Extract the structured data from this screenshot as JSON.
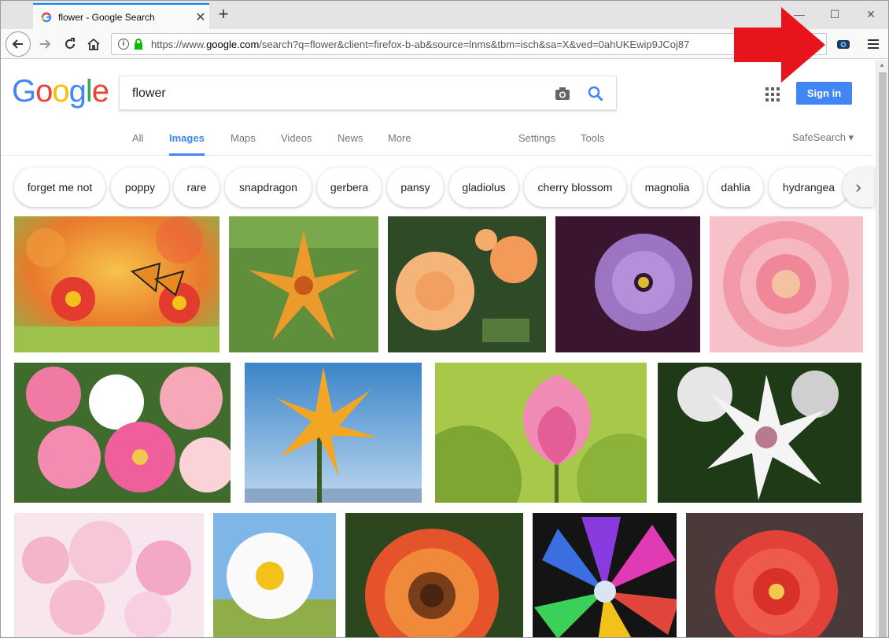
{
  "browser": {
    "tab_title": "flower - Google Search",
    "tab_close": "✕",
    "new_tab": "+",
    "url_scheme": "https://www.",
    "url_host": "google.com",
    "url_rest": "/search?q=flower&client=firefox-b-ab&source=lnms&tbm=isch&sa=X&ved=0ahUKEwip9JCoj87",
    "minimize": "—",
    "maximize": "☐",
    "close": "✕"
  },
  "google": {
    "logo_letters": [
      "G",
      "o",
      "o",
      "g",
      "l",
      "e"
    ],
    "search_value": "flower",
    "signin_label": "Sign in",
    "tabs": [
      "All",
      "Images",
      "Maps",
      "Videos",
      "News",
      "More",
      "Settings",
      "Tools"
    ],
    "safesearch_label": "SafeSearch ▾"
  },
  "chips": [
    "forget me not",
    "poppy",
    "rare",
    "snapdragon",
    "gerbera",
    "pansy",
    "gladiolus",
    "cherry blossom",
    "magnolia",
    "dahlia",
    "hydrangea"
  ],
  "chip_next_icon": "chevron-right-icon",
  "colors": {
    "accent_blue": "#4285f4",
    "annotation_red": "#e8141c",
    "logo_blue": "#4285f4",
    "logo_red": "#ea4335",
    "logo_yellow": "#fbbc05",
    "logo_green": "#34a853"
  },
  "icons": {
    "back": "back-arrow-icon",
    "forward": "forward-arrow-icon",
    "reload": "reload-icon",
    "home": "home-icon",
    "info": "info-icon",
    "lock": "lock-icon",
    "extension": "screenshot-extension-icon",
    "menu": "hamburger-menu-icon",
    "camera": "camera-icon",
    "search": "search-icon",
    "apps": "apps-grid-icon"
  }
}
